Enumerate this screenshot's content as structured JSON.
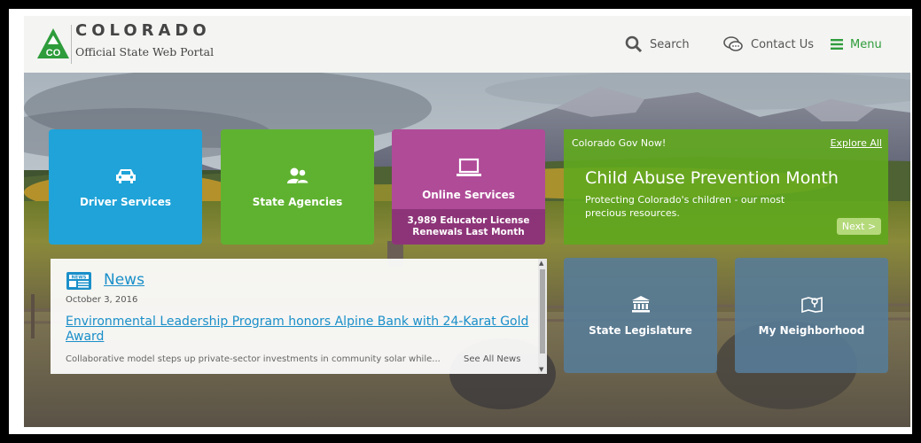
{
  "header": {
    "logo_badge": "CO",
    "logo_word": "COLORADO",
    "logo_tagline": "Official State Web Portal",
    "nav": {
      "search_label": "Search",
      "contact_label": "Contact Us",
      "menu_label": "Menu"
    }
  },
  "tiles": {
    "driver": {
      "label": "Driver Services",
      "icon": "car-icon",
      "color": "#1fa3d8"
    },
    "agencies": {
      "label": "State Agencies",
      "icon": "people-icon",
      "color": "#5fb230"
    },
    "online": {
      "label": "Online Services",
      "icon": "laptop-icon",
      "color": "#b04b98",
      "stat_line1": "3,989 Educator License",
      "stat_line2": "Renewals Last Month"
    },
    "legislature": {
      "label": "State Legislature",
      "icon": "capitol-icon"
    },
    "neighborhood": {
      "label": "My Neighborhood",
      "icon": "map-pin-icon"
    }
  },
  "gov_now": {
    "label": "Colorado Gov Now!",
    "explore": "Explore All",
    "title": "Child Abuse Prevention Month",
    "desc_line1": "Protecting Colorado's children - our most",
    "desc_line2": "precious resources.",
    "next": "Next >"
  },
  "news": {
    "heading": "News",
    "date": "October 3, 2016",
    "headline": "Environmental Leadership Program honors Alpine Bank with 24-Karat Gold Award",
    "summary": "Collaborative model steps up private-sector investments in community solar while...",
    "see_all": "See All News"
  },
  "colors": {
    "accent_green": "#2e9c3b",
    "link_blue": "#1a8fc9"
  }
}
